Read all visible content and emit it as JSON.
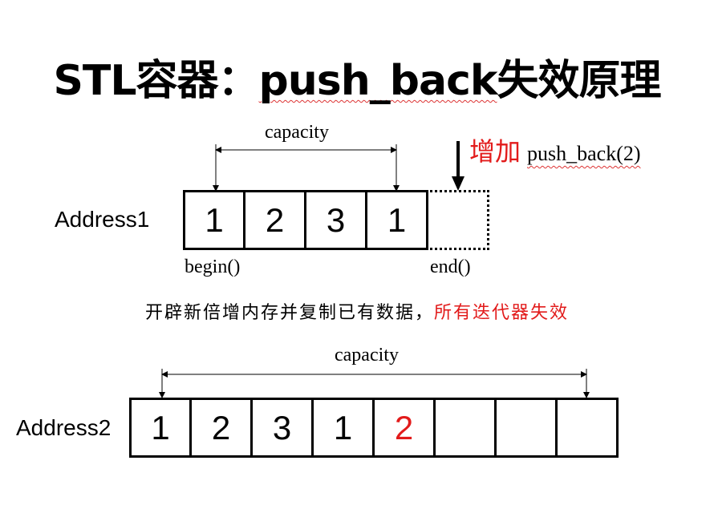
{
  "title": {
    "prefix": "STL容器：",
    "func": "push_back",
    "suffix": "失效原理"
  },
  "top": {
    "capacity_label": "capacity",
    "address_label": "Address1",
    "cells": [
      "1",
      "2",
      "3",
      "1"
    ],
    "begin_label": "begin()",
    "end_label": "end()",
    "increase_word": "增加",
    "push_call": "push_back(2)"
  },
  "explanation": {
    "text": "开辟新倍增内存并复制已有数据，",
    "highlight": "所有迭代器失效"
  },
  "bottom": {
    "capacity_label": "capacity",
    "address_label": "Address2",
    "cells": [
      "1",
      "2",
      "3",
      "1",
      "2",
      "",
      "",
      ""
    ],
    "highlight_index": 4
  },
  "colors": {
    "highlight": "#e21b1b"
  }
}
